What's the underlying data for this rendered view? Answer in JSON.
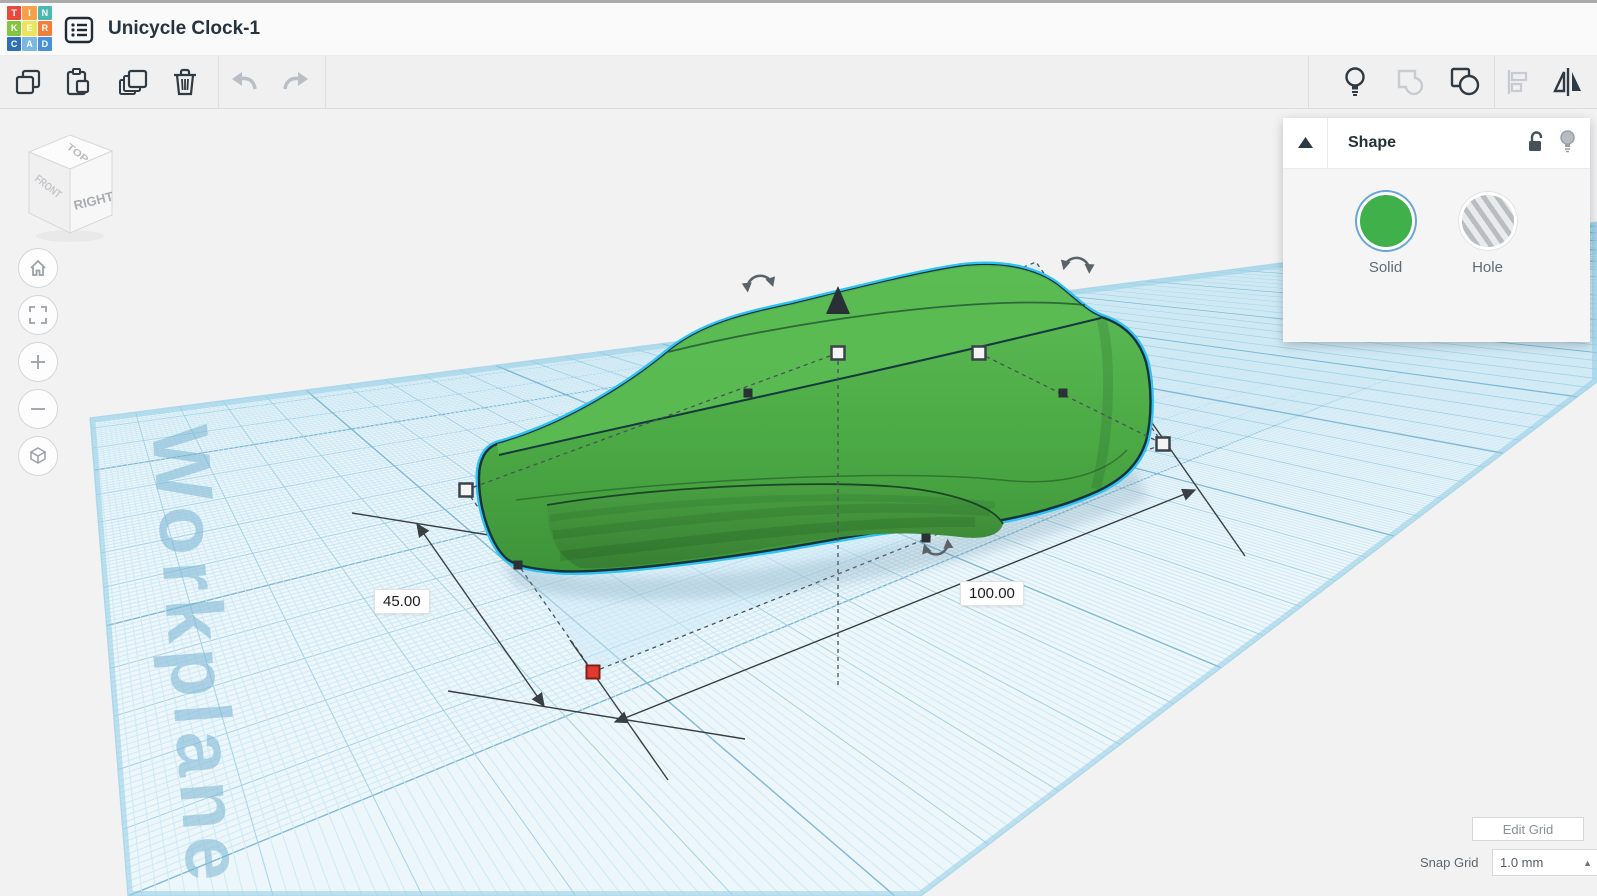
{
  "header": {
    "logo_letters": [
      "T",
      "I",
      "N",
      "K",
      "E",
      "R",
      "C",
      "A",
      "D"
    ],
    "logo_name": "tinkercad-logo",
    "title": "Unicycle Clock-1"
  },
  "toolbar": {
    "left_icons": [
      "copy",
      "paste",
      "duplicate",
      "delete",
      "undo",
      "redo"
    ],
    "right_icons": [
      "show-all-lights",
      "group",
      "ungroup",
      "align",
      "mirror"
    ]
  },
  "view_cube": {
    "top": "TOP",
    "front": "FRONT",
    "right": "RIGHT"
  },
  "navigation_icons": [
    "home-view",
    "fit-view",
    "zoom-in",
    "zoom-out",
    "perspective-toggle"
  ],
  "workplane": {
    "label": "Workplane"
  },
  "selection": {
    "depth_dimension": "45.00",
    "width_dimension": "100.00",
    "handle_colors": {
      "corner": "#f4f4f4",
      "edge": "#2a3136",
      "anchor": "#e23b2e"
    }
  },
  "shape_panel": {
    "title": "Shape",
    "options": [
      {
        "label": "Solid",
        "selected": true
      },
      {
        "label": "Hole",
        "selected": false
      }
    ]
  },
  "footer": {
    "edit_grid": "Edit Grid",
    "snap_grid_label": "Snap Grid",
    "snap_grid_value": "1.0 mm"
  },
  "colors": {
    "selection_outline": "#2fc2f2",
    "solid_green": "#4caf46",
    "grid_blue": "#a4d2e7",
    "background": "#f2f2f3"
  }
}
